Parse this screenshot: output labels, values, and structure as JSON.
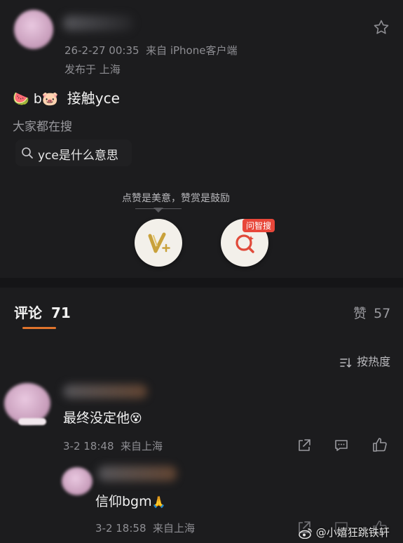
{
  "post": {
    "timestamp_source": "26-2-27 00:35  来自 iPhone客户端",
    "location": "发布于 上海",
    "content": "接触yce",
    "emoji_prefix": "🍉 b🐷"
  },
  "trending": {
    "label": "大家都在搜",
    "query": "yce是什么意思"
  },
  "reward": {
    "hint": "点赞是美意，赞赏是鼓励",
    "ai_badge": "问智搜"
  },
  "tabs": {
    "comments_label": "评论",
    "comments_count": "71",
    "likes_label": "赞",
    "likes_count": "57"
  },
  "sort": {
    "label": "按热度"
  },
  "comments": [
    {
      "text": "最终没定他",
      "emoji": "😵",
      "meta": "3-2 18:48  来自上海"
    },
    {
      "text": "信仰bgm",
      "emoji": "🙏",
      "meta": "3-2 18:58  来自上海"
    }
  ],
  "watermark": "@小嬉狂跳铁轩"
}
